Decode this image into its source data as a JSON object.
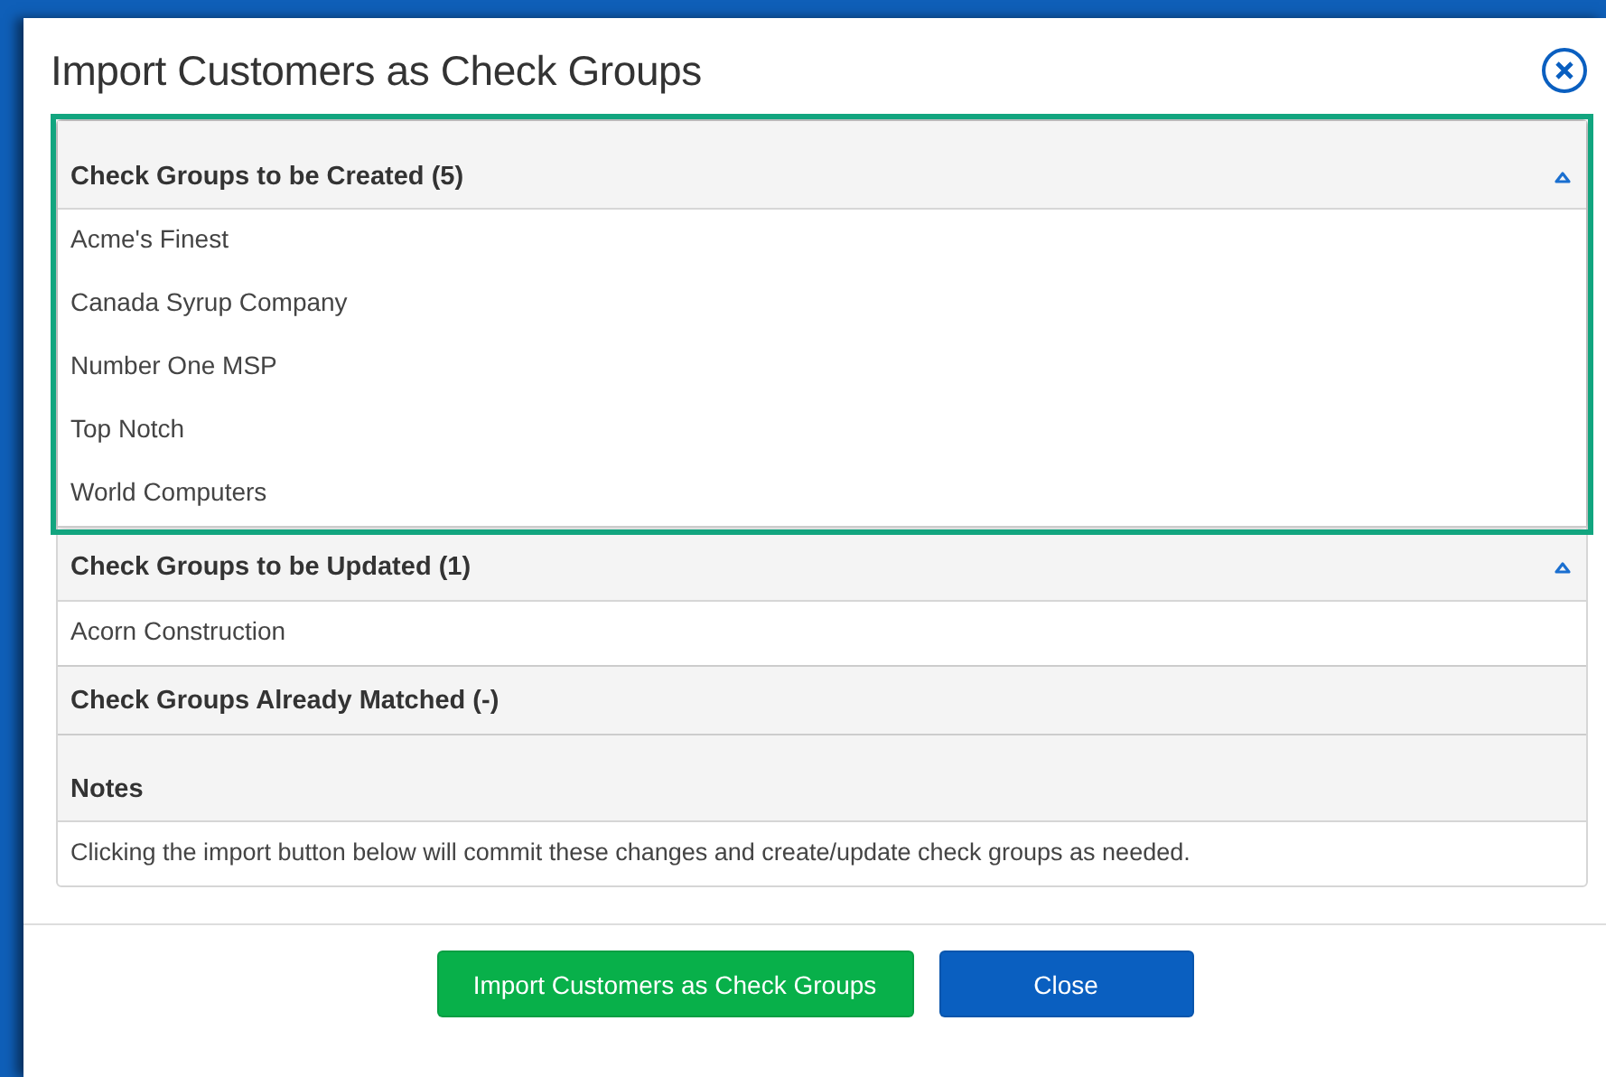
{
  "dialog": {
    "title": "Import Customers as Check Groups"
  },
  "sections": [
    {
      "kind": "list",
      "title": "Check Groups to be Created (5)",
      "highlighted": true,
      "collapsible": true,
      "items": [
        "Acme's Finest",
        "Canada Syrup Company",
        "Number One MSP",
        "Top Notch",
        "World Computers"
      ]
    },
    {
      "kind": "list",
      "title": "Check Groups to be Updated (1)",
      "highlighted": false,
      "collapsible": true,
      "items": [
        "Acorn Construction"
      ]
    },
    {
      "kind": "list",
      "title": "Check Groups Already Matched (-)",
      "highlighted": false,
      "collapsible": false
    },
    {
      "kind": "note",
      "title": "Notes",
      "highlighted": false,
      "collapsible": false,
      "text": "Clicking the import button below will commit these changes and create/update check groups as needed."
    }
  ],
  "buttons": [
    {
      "label": "Import Customers as Check Groups",
      "kind": "primary"
    },
    {
      "label": "Close",
      "kind": "secondary"
    }
  ]
}
